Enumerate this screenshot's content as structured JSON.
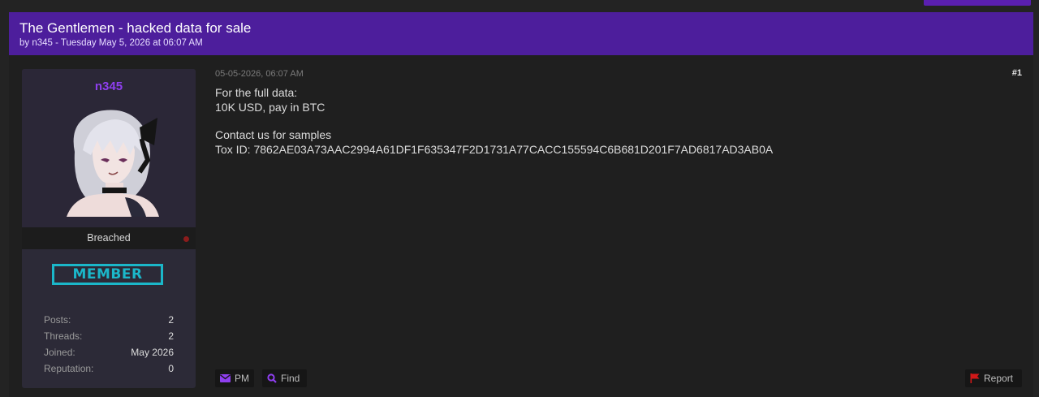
{
  "thread": {
    "title": "The Gentlemen - hacked data for sale",
    "meta": "by n345 - Tuesday May 5, 2026 at 06:07 AM"
  },
  "author": {
    "username": "n345",
    "rank_title": "Breached",
    "badge": "MEMBER",
    "stats": [
      {
        "label": "Posts:",
        "value": "2"
      },
      {
        "label": "Threads:",
        "value": "2"
      },
      {
        "label": "Joined:",
        "value": "May 2026"
      },
      {
        "label": "Reputation:",
        "value": "0"
      }
    ]
  },
  "post": {
    "date": "05-05-2026, 06:07 AM",
    "number": "#1",
    "lines": [
      "For the full data:",
      "10K USD, pay in BTC",
      "",
      "Contact us for samples",
      "Tox ID: 7862AE03A73AAC2994A61DF1F635347F2D1731A77CACC155594C6B681D201F7AD6817AD3AB0A"
    ]
  },
  "actions": {
    "pm_label": "PM",
    "find_label": "Find",
    "report_label": "Report"
  },
  "colors": {
    "header_bg": "#4d1e9c",
    "username": "#8f3ff0",
    "badge": "#1bb7c9",
    "report_flag": "#d01818"
  },
  "icons": {
    "pm": "envelope-icon",
    "find": "search-icon",
    "report": "flag-icon",
    "status": "offline-dot-icon"
  }
}
